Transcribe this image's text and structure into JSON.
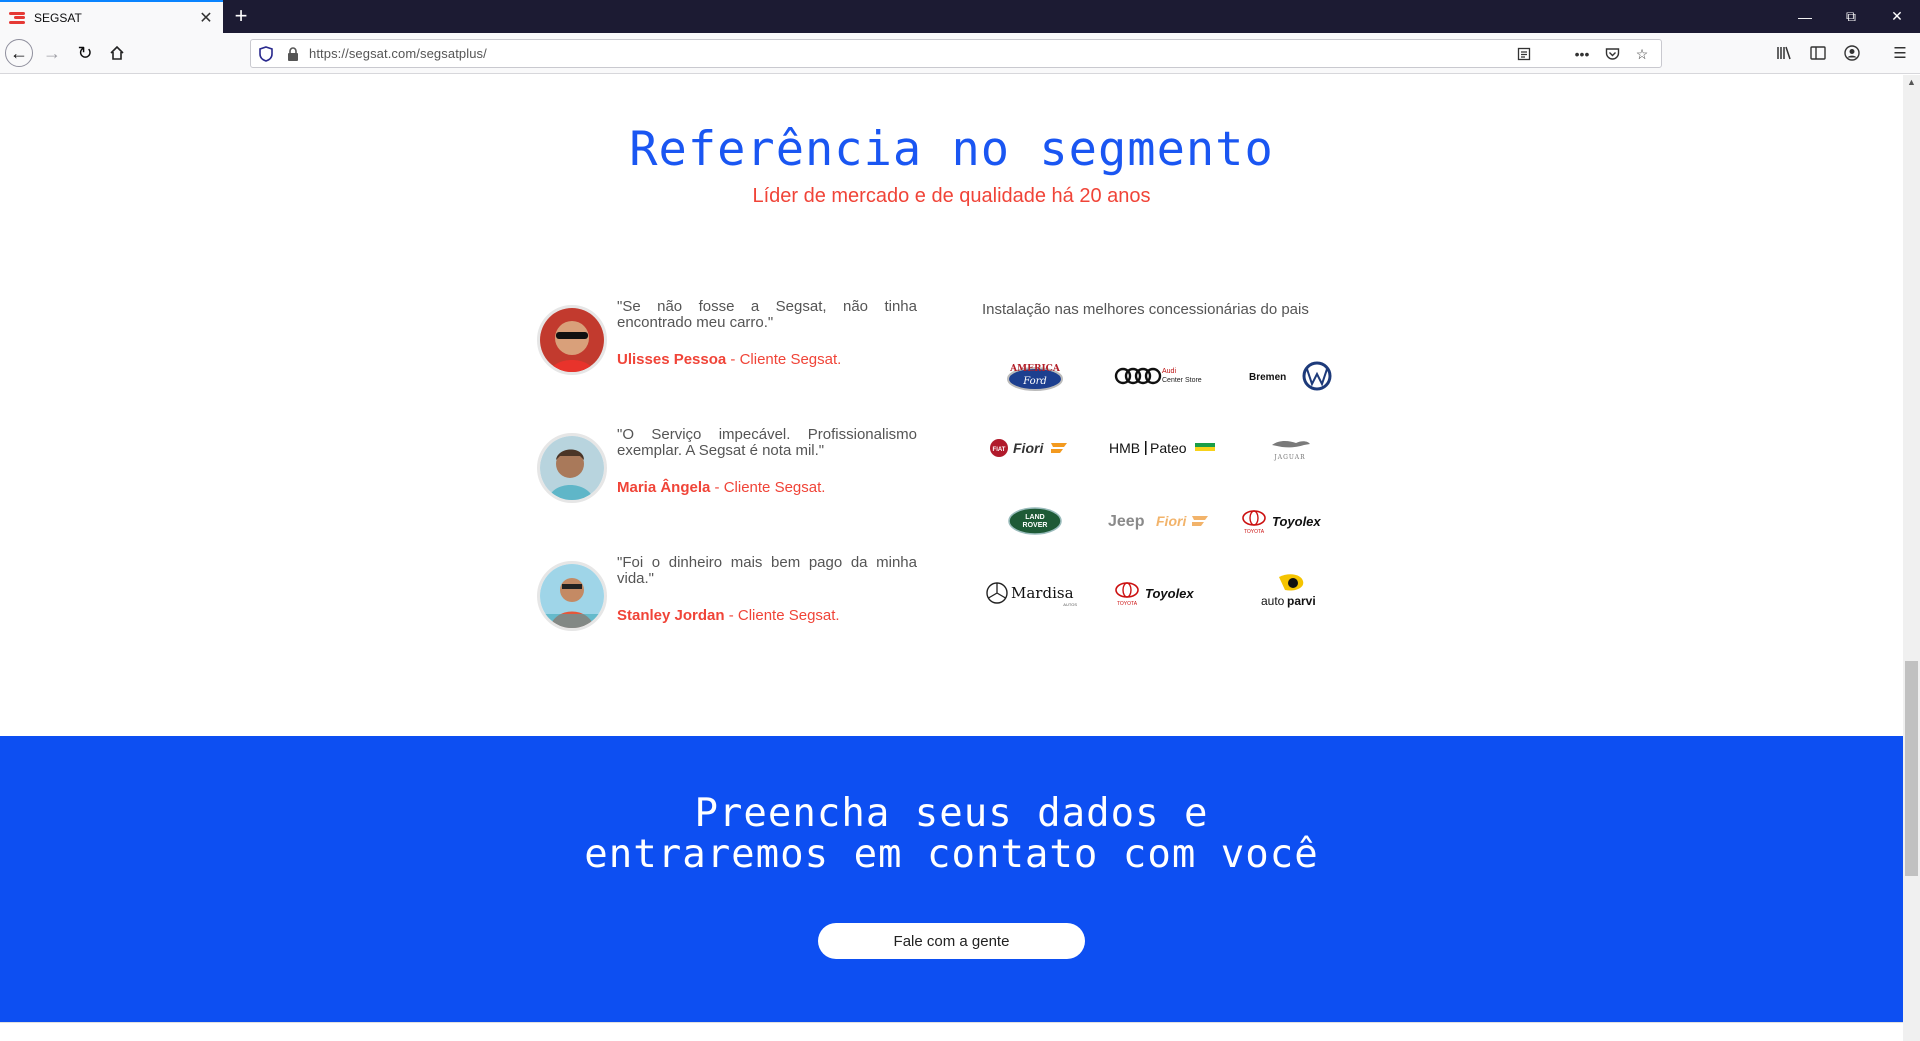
{
  "browser": {
    "tab_title": "SEGSAT",
    "url": "https://segsat.com/segsatplus/"
  },
  "reference": {
    "title": "Referência no segmento",
    "subtitle": "Líder de mercado e de qualidade há 20 anos"
  },
  "testimonials": [
    {
      "quote": "\"Se não fosse a Segsat, não tinha encontrado meu carro.\"",
      "name": "Ulisses Pessoa",
      "suffix": " - Cliente Segsat."
    },
    {
      "quote": "\"O Serviço impecável. Profissionalismo exemplar. A Segsat é nota mil.\"",
      "name": "Maria Ângela",
      "suffix": " - Cliente Segsat."
    },
    {
      "quote": "\"Foi o dinheiro mais bem pago da minha vida.\"",
      "name": "Stanley Jordan",
      "suffix": " - Cliente Segsat."
    }
  ],
  "dealers": {
    "title": "Instalação nas melhores concessionárias do pais",
    "logos": {
      "america_ford": {
        "top": "AMERICA",
        "bottom": "Ford"
      },
      "audi": {
        "line1": "Audi",
        "line2": "Center Store"
      },
      "bremen": "Bremen",
      "fiori": "Fiori",
      "hmb": {
        "left": "HMB",
        "right": "Pateo"
      },
      "jaguar": "JAGUAR",
      "land_rover": {
        "line1": "LAND",
        "line2": "ROVER"
      },
      "jeep": "Jeep",
      "toyota": "TOYOTA",
      "toyolex": "Toyolex",
      "mardisa": {
        "name": "Mardisa",
        "sub": "AUTOS"
      },
      "autoparvi": {
        "auto": "auto",
        "parvi": "parvi"
      }
    }
  },
  "cta": {
    "title_line1": "Preencha seus dados e",
    "title_line2": "entraremos em contato com você",
    "button": "Fale com a gente"
  }
}
